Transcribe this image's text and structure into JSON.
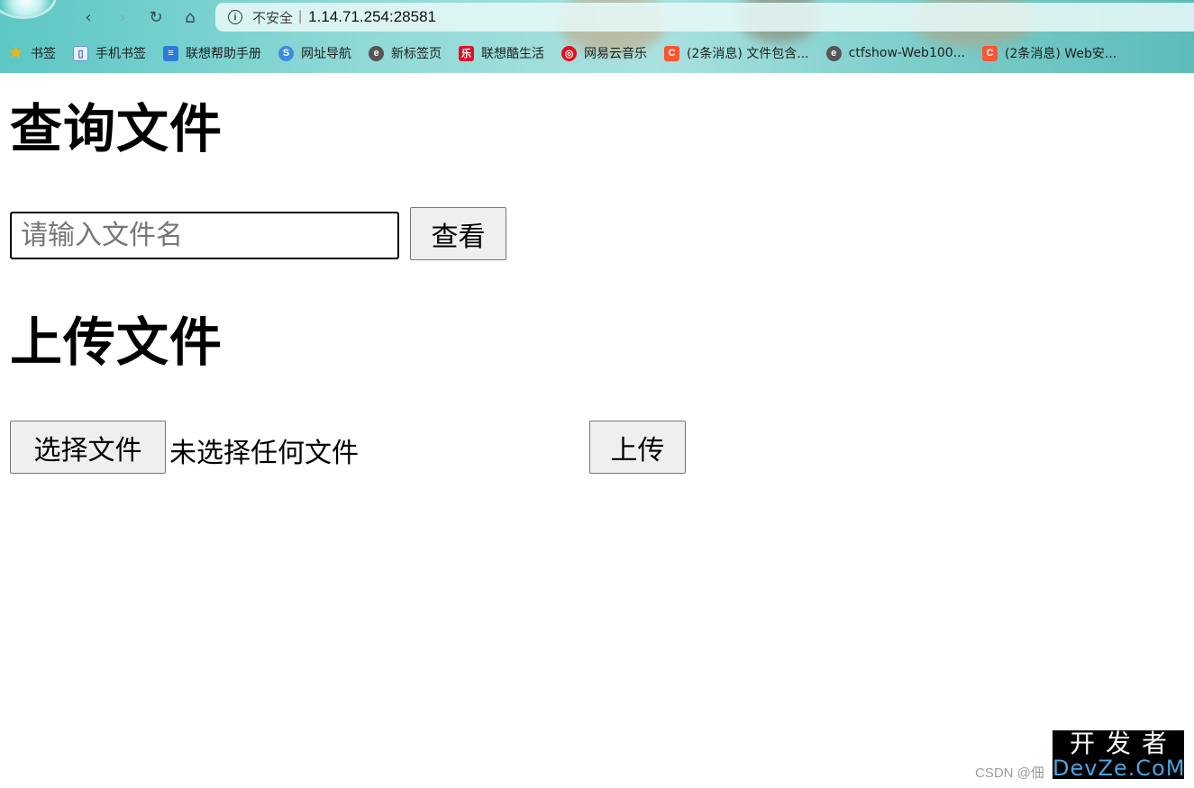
{
  "browser": {
    "nav": {
      "back": "‹",
      "forward": "›",
      "reload": "↻",
      "home": "⌂"
    },
    "address": {
      "security_icon": "info-icon",
      "security_text": "不安全",
      "separator": "|",
      "url": "1.14.71.254:28581"
    },
    "bookmarks": [
      {
        "label": "书签",
        "icon": "star-icon",
        "glyph": "★"
      },
      {
        "label": "手机书签",
        "icon": "phone-icon",
        "glyph": "▯"
      },
      {
        "label": "联想帮助手册",
        "icon": "document-icon",
        "glyph": "≡"
      },
      {
        "label": "网址导航",
        "icon": "navigation-icon",
        "glyph": "S"
      },
      {
        "label": "新标签页",
        "icon": "browser-e-icon",
        "glyph": "e"
      },
      {
        "label": "联想酷生活",
        "icon": "lenovo-icon",
        "glyph": "乐"
      },
      {
        "label": "网易云音乐",
        "icon": "netease-music-icon",
        "glyph": "◎"
      },
      {
        "label": "(2条消息) 文件包含...",
        "icon": "csdn-icon",
        "glyph": "C"
      },
      {
        "label": "ctfshow-Web100...",
        "icon": "browser-e-icon",
        "glyph": "e"
      },
      {
        "label": "(2条消息) Web安...",
        "icon": "csdn-icon",
        "glyph": "C"
      }
    ]
  },
  "page": {
    "query_heading": "查询文件",
    "search_placeholder": "请输入文件名",
    "search_value": "",
    "view_button": "查看",
    "upload_heading": "上传文件",
    "choose_file_button": "选择文件",
    "no_file_text": "未选择任何文件",
    "upload_button": "上传"
  },
  "watermark": {
    "csdn": "CSDN @佃",
    "devze_cn": "开发者",
    "devze_en": "DevZe.CoM"
  }
}
